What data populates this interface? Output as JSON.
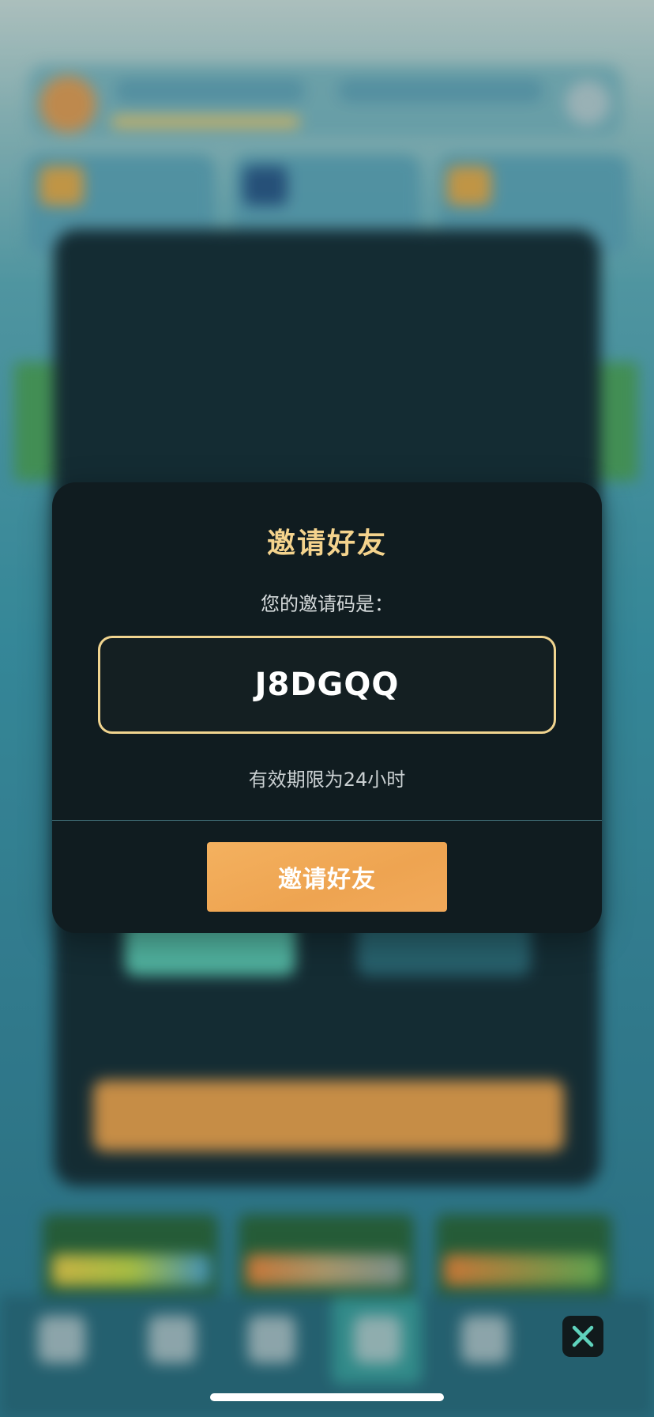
{
  "modal": {
    "title": "邀请好友",
    "subtitle": "您的邀请码是：",
    "invite_code": "J8DGQQ",
    "validity_note": "有效期限为24小时",
    "invite_button_label": "邀请好友"
  },
  "icons": {
    "close": "close-icon"
  },
  "colors": {
    "title_gold": "#f4d38d",
    "code_border": "#f0d48f",
    "button_orange": "#eea451",
    "modal_bg": "#101c20",
    "close_icon_teal": "#5fd3bd"
  }
}
